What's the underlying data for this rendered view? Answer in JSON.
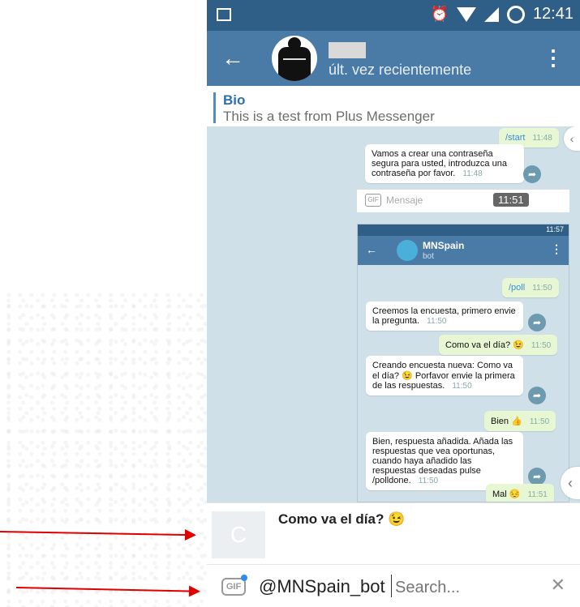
{
  "status_bar": {
    "time": "12:41"
  },
  "header": {
    "subtitle": "últ. vez recientemente",
    "back_icon": "arrow-left-icon",
    "menu_icon": "kebab-menu-icon"
  },
  "bio": {
    "label": "Bio",
    "text": "This is a test from Plus Messenger"
  },
  "chat": {
    "top_messages": [
      {
        "text": "/start",
        "time": "11:48",
        "kind": "sent"
      },
      {
        "text": "Vamos a crear una contraseña segura para usted, introduzca una contraseña por favor.",
        "time": "11:48",
        "kind": "received"
      }
    ],
    "mini_input": {
      "placeholder": "Mensaje",
      "time_badge": "11:51"
    },
    "inner_screen": {
      "status_time": "11:57",
      "title": "MNSpain",
      "subtitle": "bot",
      "messages": [
        {
          "text": "/poll",
          "time": "11:50",
          "kind": "sent"
        },
        {
          "text": "Creemos la encuesta, primero envie la pregunta.",
          "time": "11:50",
          "kind": "received"
        },
        {
          "text": "Como va el día? 😉",
          "time": "11:50",
          "kind": "sent"
        },
        {
          "text": "Creando encuesta nueva: Como va el día? 😉 Porfavor envie la primera de las respuestas.",
          "time": "11:50",
          "kind": "received"
        },
        {
          "text": "Bien 👍",
          "time": "11:50",
          "kind": "sent"
        },
        {
          "text": "Bien, respuesta añadida. Añada las respuestas que vea oportunas, cuando haya añadido las respuestas deseadas pulse /polldone.",
          "time": "11:50",
          "kind": "received"
        },
        {
          "text": "Mal 😔",
          "time": "11:51",
          "kind": "sent"
        }
      ]
    }
  },
  "result_item": {
    "thumb_letter": "C",
    "title": "Como va el día? 😉"
  },
  "input_bar": {
    "gif_label": "GIF",
    "bot_username": "@MNSpain_bot",
    "search_placeholder": "Search...",
    "close_symbol": "✕"
  },
  "colors": {
    "status_bar": "#2f5e86",
    "header": "#4a7aa6",
    "accent": "#2c6fb0",
    "arrow_red": "#e00000",
    "chat_bg": "#cfe0e8"
  }
}
